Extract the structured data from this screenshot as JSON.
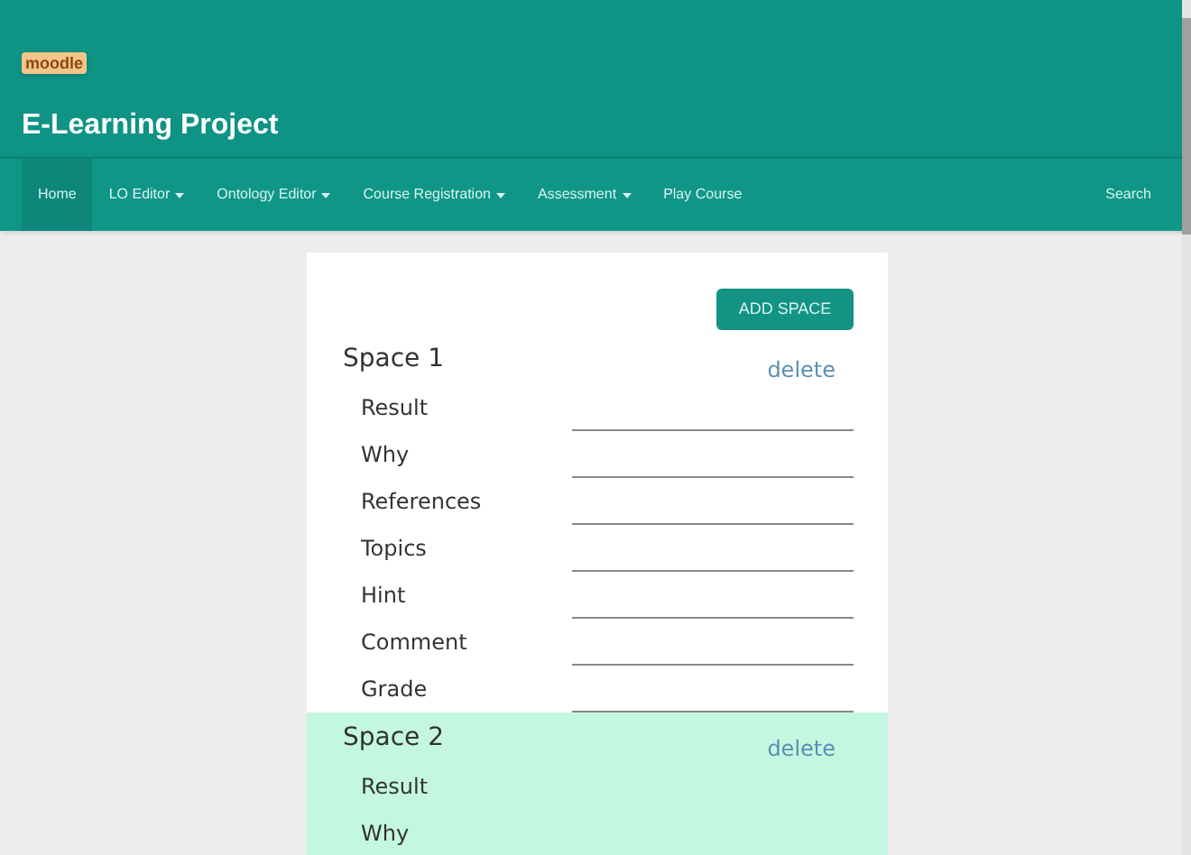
{
  "header": {
    "logo": "moodle",
    "title": "E-Learning Project"
  },
  "nav": {
    "items": [
      {
        "label": "Home",
        "dropdown": false,
        "selected": true
      },
      {
        "label": "LO Editor",
        "dropdown": true,
        "selected": false
      },
      {
        "label": "Ontology Editor",
        "dropdown": true,
        "selected": false
      },
      {
        "label": "Course Registration",
        "dropdown": true,
        "selected": false
      },
      {
        "label": "Assessment",
        "dropdown": true,
        "selected": false
      },
      {
        "label": "Play Course",
        "dropdown": false,
        "selected": false
      }
    ],
    "search": "Search"
  },
  "add_button": "ADD SPACE",
  "spaces": [
    {
      "title": "Space 1",
      "delete": "delete",
      "highlighted": false,
      "fields": [
        "Result",
        "Why",
        "References",
        "Topics",
        "Hint",
        "Comment",
        "Grade"
      ]
    },
    {
      "title": "Space 2",
      "delete": "delete",
      "highlighted": true,
      "fields": [
        "Result",
        "Why"
      ]
    }
  ]
}
